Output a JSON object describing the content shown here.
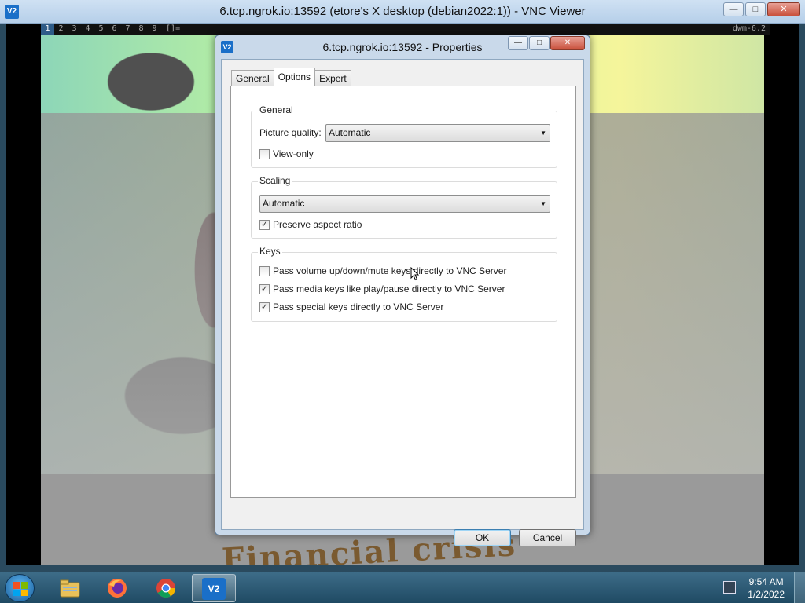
{
  "outer_window": {
    "icon_text": "V2",
    "title": "6.tcp.ngrok.io:13592 (etore's X desktop (debian2022:1)) - VNC Viewer",
    "minimize_icon": "minimize-icon",
    "maximize_icon": "maximize-icon",
    "close_icon": "close-icon"
  },
  "remote_desktop": {
    "workspaces": [
      "1",
      "2",
      "3",
      "4",
      "5",
      "6",
      "7",
      "8",
      "9"
    ],
    "active_workspace": "1",
    "layout_symbol": "[]=",
    "status_text": "dwm-6.2",
    "wallpaper_text": "Financial crisis"
  },
  "dialog": {
    "icon_text": "V2",
    "title": "6.tcp.ngrok.io:13592 - Properties",
    "tabs": [
      {
        "label": "General",
        "active": false
      },
      {
        "label": "Options",
        "active": true
      },
      {
        "label": "Expert",
        "active": false
      }
    ],
    "groups": {
      "general": {
        "title": "General",
        "picture_quality_label": "Picture quality:",
        "picture_quality_value": "Automatic",
        "view_only_label": "View-only",
        "view_only_checked": false
      },
      "scaling": {
        "title": "Scaling",
        "scaling_value": "Automatic",
        "preserve_aspect_label": "Preserve aspect ratio",
        "preserve_aspect_checked": true
      },
      "keys": {
        "title": "Keys",
        "items": [
          {
            "label": "Pass volume up/down/mute keys directly to VNC Server",
            "checked": false
          },
          {
            "label": "Pass media keys like play/pause directly to VNC Server",
            "checked": true
          },
          {
            "label": "Pass special keys directly to VNC Server",
            "checked": true
          }
        ]
      }
    },
    "ok_label": "OK",
    "cancel_label": "Cancel"
  },
  "taskbar": {
    "pinned": [
      {
        "name": "windows-explorer-icon"
      },
      {
        "name": "firefox-icon"
      },
      {
        "name": "chrome-icon"
      },
      {
        "name": "vnc-viewer-icon",
        "active": true
      }
    ],
    "vnc_icon_text": "V2",
    "time": "9:54 AM",
    "date": "1/2/2022"
  },
  "colors": {
    "accent": "#1a6fc8",
    "close_button": "#c9513c",
    "taskbar": "#1f4a63"
  }
}
